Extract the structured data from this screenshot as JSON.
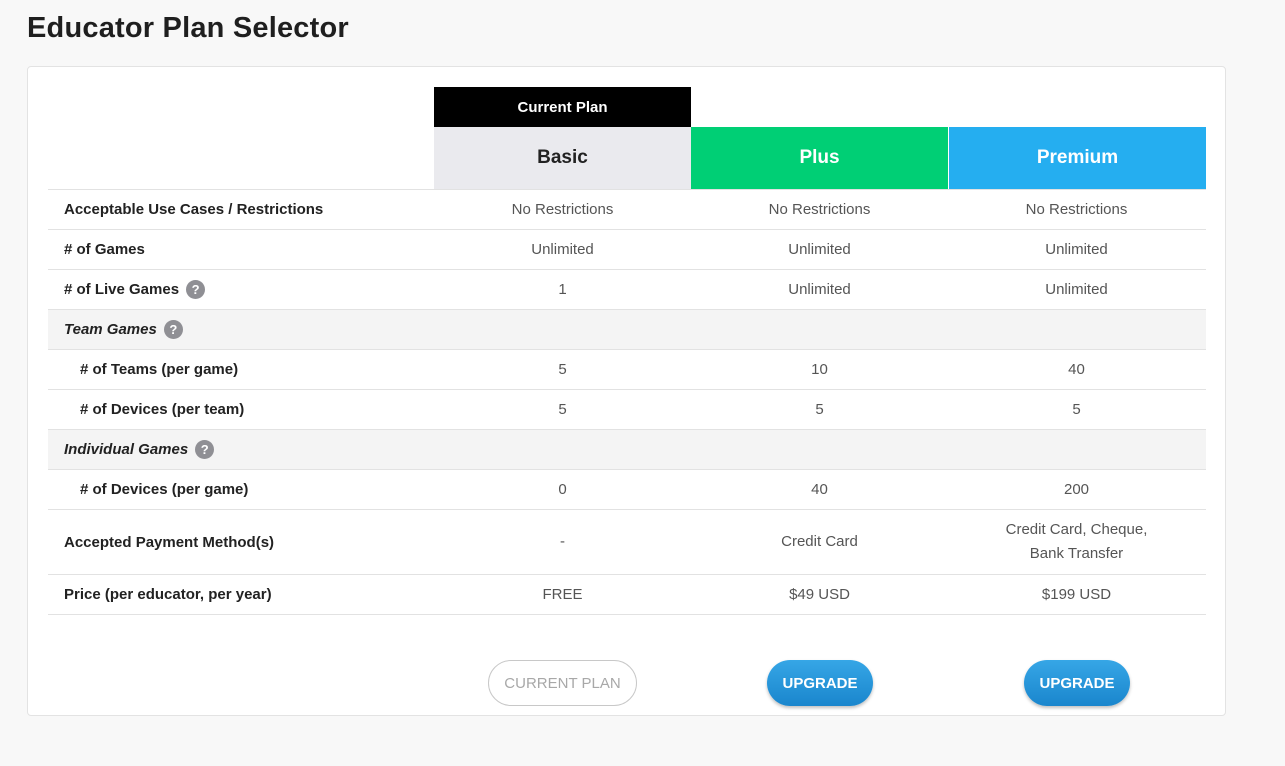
{
  "page_title": "Educator Plan Selector",
  "current_plan_tag": "Current Plan",
  "plans": [
    {
      "name": "Basic",
      "color": "#eaeaee"
    },
    {
      "name": "Plus",
      "color": "#00cf75"
    },
    {
      "name": "Premium",
      "color": "#25aef0"
    }
  ],
  "rows": [
    {
      "label": "Acceptable Use Cases / Restrictions",
      "values": [
        "No Restrictions",
        "No Restrictions",
        "No Restrictions"
      ]
    },
    {
      "label": "# of Games",
      "values": [
        "Unlimited",
        "Unlimited",
        "Unlimited"
      ]
    },
    {
      "label": "# of Live Games",
      "values": [
        "1",
        "Unlimited",
        "Unlimited"
      ]
    },
    {
      "label": "Team Games"
    },
    {
      "label": "# of Teams (per game)",
      "values": [
        "5",
        "10",
        "40"
      ]
    },
    {
      "label": "# of Devices (per team)",
      "values": [
        "5",
        "5",
        "5"
      ]
    },
    {
      "label": "Individual Games"
    },
    {
      "label": "# of Devices (per game)",
      "values": [
        "0",
        "40",
        "200"
      ]
    },
    {
      "label": "Accepted Payment Method(s)",
      "values": [
        "-",
        "Credit Card",
        "Credit Card, Cheque, Bank Transfer"
      ]
    },
    {
      "label": "Price (per educator, per year)",
      "values": [
        "FREE",
        "$49 USD",
        "$199 USD"
      ]
    }
  ],
  "help_icon": "?",
  "buttons": {
    "current": "CURRENT PLAN",
    "upgrade_plus": "UPGRADE",
    "upgrade_premium": "UPGRADE"
  }
}
